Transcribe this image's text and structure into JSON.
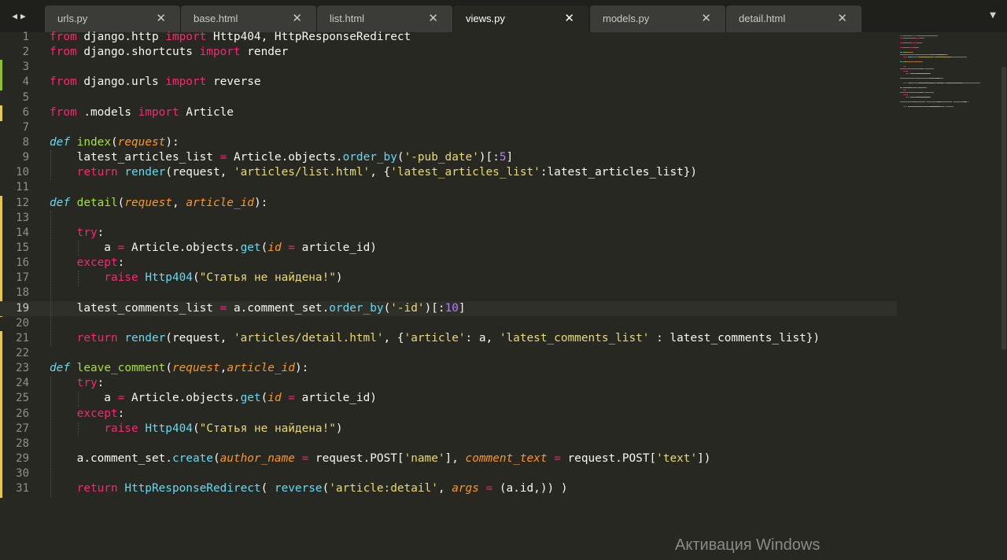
{
  "tabs": [
    {
      "label": "urls.py",
      "active": false
    },
    {
      "label": "base.html",
      "active": false
    },
    {
      "label": "list.html",
      "active": false
    },
    {
      "label": "views.py",
      "active": true
    },
    {
      "label": "models.py",
      "active": false
    },
    {
      "label": "detail.html",
      "active": false
    }
  ],
  "tab_close_glyph": "✕",
  "nav_icons": [
    "arrow-left-icon",
    "arrow-right-icon"
  ],
  "tab_menu_icon": "chevron-down-icon",
  "current_line": 19,
  "code_lines": [
    [
      [
        "kw",
        "from"
      ],
      [
        "plain",
        " django.http "
      ],
      [
        "kw",
        "import"
      ],
      [
        "plain",
        " Http404, HttpResponseRedirect"
      ]
    ],
    [
      [
        "kw",
        "from"
      ],
      [
        "plain",
        " django.shortcuts "
      ],
      [
        "kw",
        "import"
      ],
      [
        "plain",
        " render"
      ]
    ],
    [],
    [
      [
        "kw",
        "from"
      ],
      [
        "plain",
        " django.urls "
      ],
      [
        "kw",
        "import"
      ],
      [
        "plain",
        " reverse"
      ]
    ],
    [],
    [
      [
        "kw",
        "from"
      ],
      [
        "plain",
        " .models "
      ],
      [
        "kw",
        "import"
      ],
      [
        "plain",
        " Article"
      ]
    ],
    [],
    [
      [
        "def",
        "def"
      ],
      [
        "plain",
        " "
      ],
      [
        "fn",
        "index"
      ],
      [
        "plain",
        "("
      ],
      [
        "param",
        "request"
      ],
      [
        "plain",
        "):"
      ]
    ],
    [
      [
        "plain",
        "    latest_articles_list "
      ],
      [
        "op",
        "="
      ],
      [
        "plain",
        " Article.objects."
      ],
      [
        "call",
        "order_by"
      ],
      [
        "plain",
        "("
      ],
      [
        "str",
        "'-pub_date'"
      ],
      [
        "plain",
        ")[:"
      ],
      [
        "num",
        "5"
      ],
      [
        "plain",
        "]"
      ]
    ],
    [
      [
        "plain",
        "    "
      ],
      [
        "kw",
        "return"
      ],
      [
        "plain",
        " "
      ],
      [
        "call",
        "render"
      ],
      [
        "plain",
        "(request, "
      ],
      [
        "str",
        "'articles/list.html'"
      ],
      [
        "plain",
        ", {"
      ],
      [
        "str",
        "'latest_articles_list'"
      ],
      [
        "plain",
        ":latest_articles_list})"
      ]
    ],
    [],
    [
      [
        "def",
        "def"
      ],
      [
        "plain",
        " "
      ],
      [
        "fn",
        "detail"
      ],
      [
        "plain",
        "("
      ],
      [
        "param",
        "request"
      ],
      [
        "plain",
        ", "
      ],
      [
        "param",
        "article_id"
      ],
      [
        "plain",
        "):"
      ]
    ],
    [],
    [
      [
        "plain",
        "    "
      ],
      [
        "kw",
        "try"
      ],
      [
        "plain",
        ":"
      ]
    ],
    [
      [
        "plain",
        "        a "
      ],
      [
        "op",
        "="
      ],
      [
        "plain",
        " Article.objects."
      ],
      [
        "call",
        "get"
      ],
      [
        "plain",
        "("
      ],
      [
        "param",
        "id"
      ],
      [
        "plain",
        " "
      ],
      [
        "op",
        "="
      ],
      [
        "plain",
        " article_id)"
      ]
    ],
    [
      [
        "plain",
        "    "
      ],
      [
        "kw",
        "except"
      ],
      [
        "plain",
        ":"
      ]
    ],
    [
      [
        "plain",
        "        "
      ],
      [
        "kw",
        "raise"
      ],
      [
        "plain",
        " "
      ],
      [
        "call",
        "Http404"
      ],
      [
        "plain",
        "("
      ],
      [
        "str",
        "\"Статья не найдена!\""
      ],
      [
        "plain",
        ")"
      ]
    ],
    [],
    [
      [
        "plain",
        "    latest_comments_list "
      ],
      [
        "op",
        "="
      ],
      [
        "plain",
        " a.comment_set."
      ],
      [
        "call",
        "order_by"
      ],
      [
        "plain",
        "("
      ],
      [
        "str",
        "'-id'"
      ],
      [
        "plain",
        ")[:"
      ],
      [
        "num",
        "10"
      ],
      [
        "plain",
        "]"
      ]
    ],
    [],
    [
      [
        "plain",
        "    "
      ],
      [
        "kw",
        "return"
      ],
      [
        "plain",
        " "
      ],
      [
        "call",
        "render"
      ],
      [
        "plain",
        "(request, "
      ],
      [
        "str",
        "'articles/detail.html'"
      ],
      [
        "plain",
        ", {"
      ],
      [
        "str",
        "'article'"
      ],
      [
        "plain",
        ": a, "
      ],
      [
        "str",
        "'latest_comments_list'"
      ],
      [
        "plain",
        " : latest_comments_list})"
      ]
    ],
    [],
    [
      [
        "def",
        "def"
      ],
      [
        "plain",
        " "
      ],
      [
        "fn",
        "leave_comment"
      ],
      [
        "plain",
        "("
      ],
      [
        "param",
        "request"
      ],
      [
        "plain",
        ","
      ],
      [
        "param",
        "article_id"
      ],
      [
        "plain",
        "):"
      ]
    ],
    [
      [
        "plain",
        "    "
      ],
      [
        "kw",
        "try"
      ],
      [
        "plain",
        ":"
      ]
    ],
    [
      [
        "plain",
        "        a "
      ],
      [
        "op",
        "="
      ],
      [
        "plain",
        " Article.objects."
      ],
      [
        "call",
        "get"
      ],
      [
        "plain",
        "("
      ],
      [
        "param",
        "id"
      ],
      [
        "plain",
        " "
      ],
      [
        "op",
        "="
      ],
      [
        "plain",
        " article_id)"
      ]
    ],
    [
      [
        "plain",
        "    "
      ],
      [
        "kw",
        "except"
      ],
      [
        "plain",
        ":"
      ]
    ],
    [
      [
        "plain",
        "        "
      ],
      [
        "kw",
        "raise"
      ],
      [
        "plain",
        " "
      ],
      [
        "call",
        "Http404"
      ],
      [
        "plain",
        "("
      ],
      [
        "str",
        "\"Статья не найдена!\""
      ],
      [
        "plain",
        ")"
      ]
    ],
    [],
    [
      [
        "plain",
        "    a.comment_set."
      ],
      [
        "call",
        "create"
      ],
      [
        "plain",
        "("
      ],
      [
        "param",
        "author_name"
      ],
      [
        "plain",
        " "
      ],
      [
        "op",
        "="
      ],
      [
        "plain",
        " request.POST["
      ],
      [
        "str",
        "'name'"
      ],
      [
        "plain",
        "], "
      ],
      [
        "param",
        "comment_text"
      ],
      [
        "plain",
        " "
      ],
      [
        "op",
        "="
      ],
      [
        "plain",
        " request.POST["
      ],
      [
        "str",
        "'text'"
      ],
      [
        "plain",
        "])"
      ]
    ],
    [],
    [
      [
        "plain",
        "    "
      ],
      [
        "kw",
        "return"
      ],
      [
        "plain",
        " "
      ],
      [
        "call",
        "HttpResponseRedirect"
      ],
      [
        "plain",
        "( "
      ],
      [
        "call",
        "reverse"
      ],
      [
        "plain",
        "("
      ],
      [
        "str",
        "'article:detail'"
      ],
      [
        "plain",
        ", "
      ],
      [
        "param",
        "args"
      ],
      [
        "plain",
        " "
      ],
      [
        "op",
        "="
      ],
      [
        "plain",
        " (a.id,)) )"
      ]
    ]
  ],
  "gutter_marks": [
    {
      "line": 3,
      "color": "#8fbe2f"
    },
    {
      "line": 4,
      "color": "#8fbe2f"
    },
    {
      "line": 6,
      "color": "#e6c84a"
    },
    {
      "line": 12,
      "color": "#e6c84a"
    },
    {
      "line": 13,
      "color": "#e6c84a"
    },
    {
      "line": 14,
      "color": "#e6c84a"
    },
    {
      "line": 15,
      "color": "#e6c84a"
    },
    {
      "line": 16,
      "color": "#e6c84a"
    },
    {
      "line": 17,
      "color": "#e6c84a"
    },
    {
      "line": 18,
      "color": "#e6c84a"
    },
    {
      "line": 19,
      "color": "#e6c84a"
    },
    {
      "line": 21,
      "color": "#e6c84a"
    },
    {
      "line": 22,
      "color": "#e6c84a"
    },
    {
      "line": 23,
      "color": "#e6c84a"
    },
    {
      "line": 24,
      "color": "#e6c84a"
    },
    {
      "line": 25,
      "color": "#e6c84a"
    },
    {
      "line": 26,
      "color": "#e6c84a"
    },
    {
      "line": 27,
      "color": "#e6c84a"
    },
    {
      "line": 28,
      "color": "#e6c84a"
    },
    {
      "line": 29,
      "color": "#e6c84a"
    },
    {
      "line": 30,
      "color": "#e6c84a"
    },
    {
      "line": 31,
      "color": "#e6c84a"
    }
  ],
  "colors": {
    "background": "#272822",
    "keyword": "#f92672",
    "string": "#e6db74",
    "function": "#a6e22e",
    "parameter": "#fd971f",
    "number": "#ae81ff",
    "builtin": "#66d9ef"
  },
  "watermark": "Активация Windows"
}
